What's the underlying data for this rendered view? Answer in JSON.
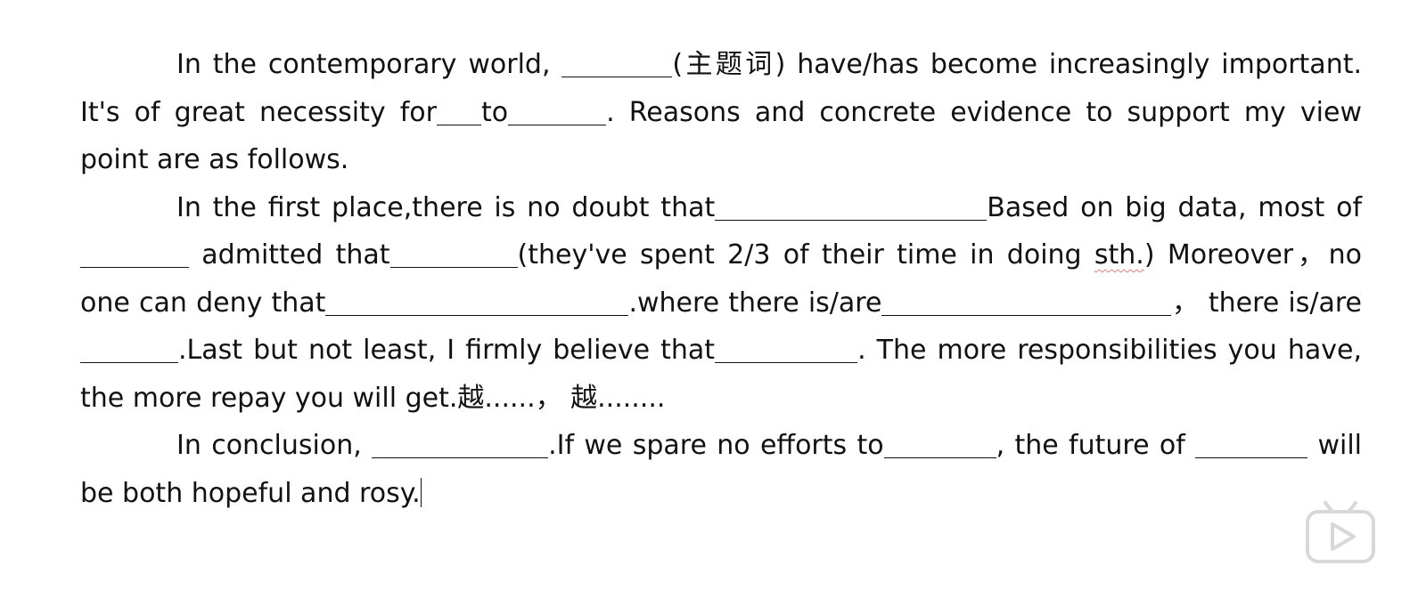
{
  "paragraphs": {
    "p1": {
      "s1": "In the contemporary world, ",
      "s2": "(主题词) have/has become increasingly important. It's of great necessity for",
      "s3": "to",
      "s4": ". Reasons and concrete evidence to support my view point are as follows."
    },
    "p2": {
      "s1": "In the first place,there is no doubt that",
      "s2": "Based on big data, most of ",
      "s3": " admitted that",
      "s4": "(they've spent 2/3 of their time in doing ",
      "s5": "sth.",
      "s6": ") Moreover，no one can deny that",
      "s7": ".where there is/are",
      "s8": "， there is/are",
      "s9": ".Last but not least, I firmly believe that",
      "s10": ". The more responsibilities you have, the more repay you will get.越......，  越........"
    },
    "p3": {
      "s1": "In conclusion, ",
      "s2": ".If we spare no efforts to",
      "s3": ", the future of ",
      "s4": " will be both hopeful and rosy."
    }
  },
  "colors": {
    "text": "#111111",
    "background": "#ffffff",
    "spellcheck_underline": "#e08080",
    "logo": "#d8d8d8"
  },
  "overlay": {
    "icon": "bilibili-tv-logo-icon"
  }
}
